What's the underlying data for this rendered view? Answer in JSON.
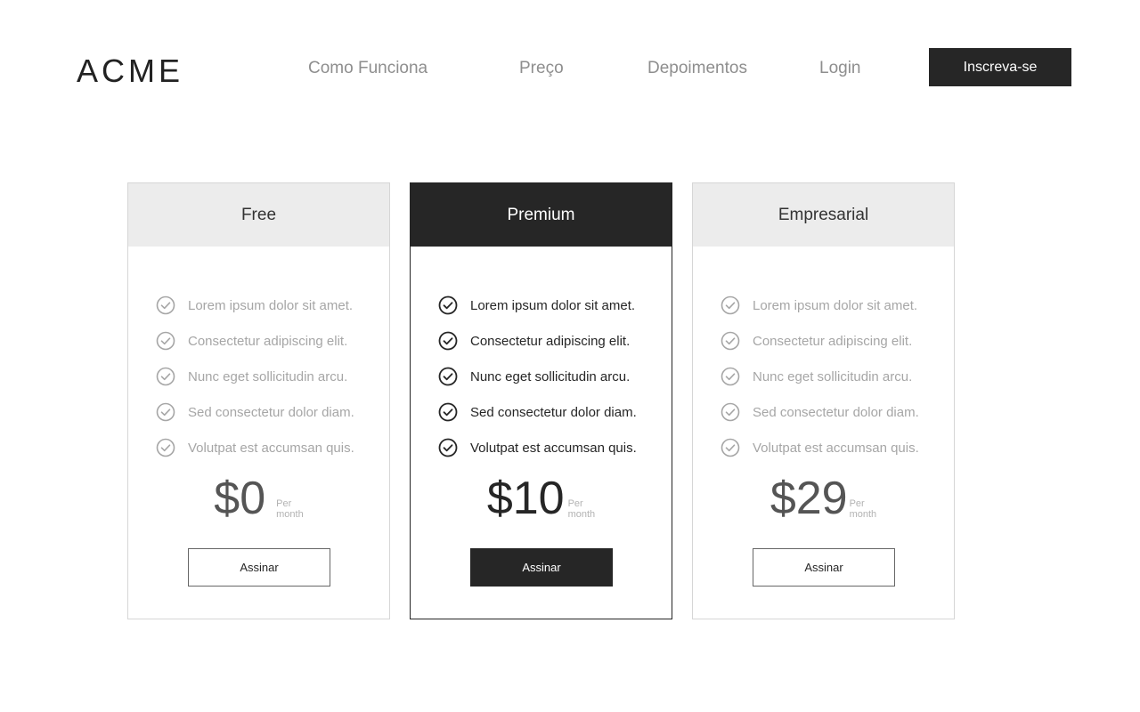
{
  "brand": {
    "logo": "ACME"
  },
  "nav": {
    "links": [
      "Como Funciona",
      "Preço",
      "Depoimentos",
      "Login"
    ],
    "cta": "Inscreva-se"
  },
  "colors": {
    "dark": "#262626",
    "muted_text": "#a6a6a6",
    "header_bg": "#ececec",
    "border": "#d6d6d6"
  },
  "plans": [
    {
      "name": "Free",
      "features": [
        "Lorem ipsum dolor sit amet.",
        "Consectetur adipiscing elit.",
        "Nunc eget sollicitudin arcu.",
        "Sed consectetur dolor diam.",
        "Volutpat est accumsan quis."
      ],
      "price": "$0",
      "per": "Per",
      "period": "month",
      "button": "Assinar",
      "featured": false
    },
    {
      "name": "Premium",
      "features": [
        "Lorem ipsum dolor sit amet.",
        "Consectetur adipiscing elit.",
        "Nunc eget sollicitudin arcu.",
        "Sed consectetur dolor diam.",
        "Volutpat est accumsan quis."
      ],
      "price": "$10",
      "per": "Per",
      "period": "month",
      "button": "Assinar",
      "featured": true
    },
    {
      "name": "Empresarial",
      "features": [
        "Lorem ipsum dolor sit amet.",
        "Consectetur adipiscing elit.",
        "Nunc eget sollicitudin arcu.",
        "Sed consectetur dolor diam.",
        "Volutpat est accumsan quis."
      ],
      "price": "$29",
      "per": "Per",
      "period": "month",
      "button": "Assinar",
      "featured": false
    }
  ],
  "icons": {
    "feature": "check-circle-icon"
  }
}
